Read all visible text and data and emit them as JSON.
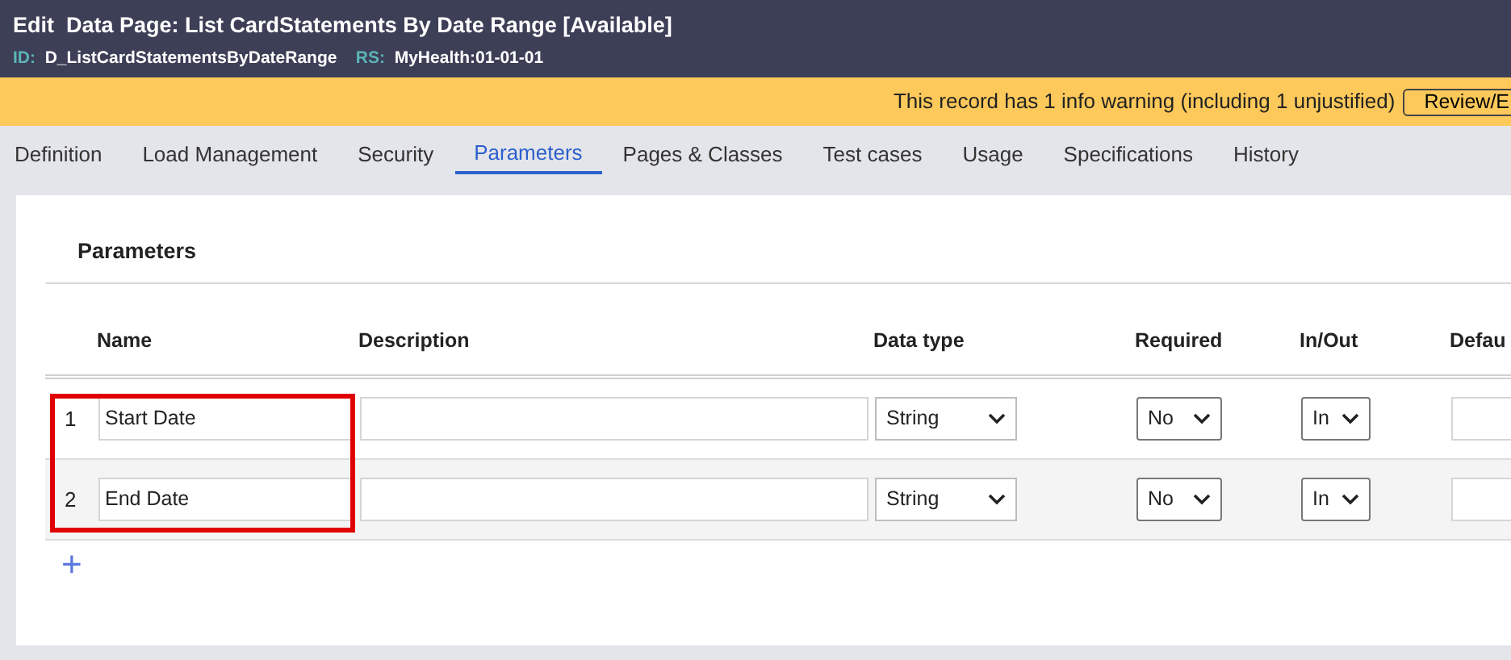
{
  "header": {
    "action": "Edit",
    "title": "Data Page: List CardStatements By Date Range [Available]",
    "id_label": "ID:",
    "id": "D_ListCardStatementsByDateRange",
    "rs_label": "RS:",
    "rs": "MyHealth:01-01-01"
  },
  "warning": {
    "text": "This record has 1 info warning (including 1 unjustified)",
    "button": "Review/E"
  },
  "tabs": [
    {
      "label": "Definition",
      "selected": false
    },
    {
      "label": "Load Management",
      "selected": false
    },
    {
      "label": "Security",
      "selected": false
    },
    {
      "label": "Parameters",
      "selected": true
    },
    {
      "label": "Pages & Classes",
      "selected": false
    },
    {
      "label": "Test cases",
      "selected": false
    },
    {
      "label": "Usage",
      "selected": false
    },
    {
      "label": "Specifications",
      "selected": false
    },
    {
      "label": "History",
      "selected": false
    }
  ],
  "section": {
    "title": "Parameters"
  },
  "table": {
    "columns": [
      "Name",
      "Description",
      "Data type",
      "Required",
      "In/Out",
      "Defau"
    ],
    "rows": [
      {
        "index": "1",
        "name": "Start Date",
        "data_type": "String",
        "required": "No",
        "in_out": "In",
        "highlighted": true
      },
      {
        "index": "2",
        "name": "End Date",
        "data_type": "String",
        "required": "No",
        "in_out": "In",
        "highlighted": true
      }
    ],
    "add_button": "+"
  }
}
